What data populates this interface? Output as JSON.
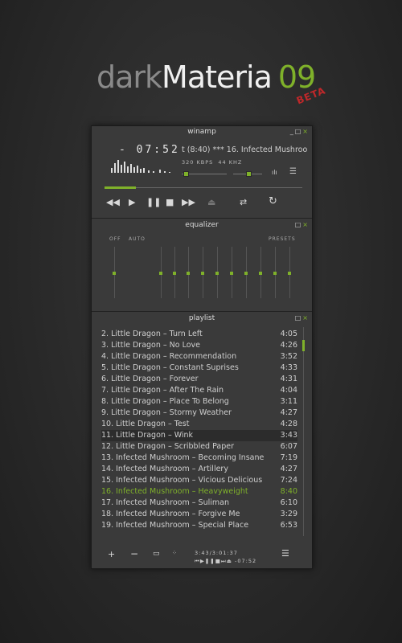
{
  "logo": {
    "dark": "dark",
    "materia": "Materia",
    "version": "09",
    "beta": "BETA"
  },
  "windows": {
    "main": "winamp",
    "eq": "equalizer",
    "playlist": "playlist"
  },
  "main": {
    "time": "- 07:52",
    "ticker": "t (8:40)  *** 16. Infected Mushroom",
    "kbps": "320",
    "kbps_label": "KBPS",
    "khz": "44",
    "khz_label": "KHZ",
    "seek_progress": 0.16
  },
  "eq": {
    "off": "OFF",
    "auto": "AUTO",
    "presets": "PRESETS"
  },
  "playlist": [
    {
      "title": "2. Little Dragon – Turn Left",
      "dur": "4:05"
    },
    {
      "title": "3. Little Dragon – No Love",
      "dur": "4:26"
    },
    {
      "title": "4. Little Dragon – Recommendation",
      "dur": "3:52"
    },
    {
      "title": "5. Little Dragon – Constant Suprises",
      "dur": "4:33"
    },
    {
      "title": "6. Little Dragon – Forever",
      "dur": "4:31"
    },
    {
      "title": "7. Little Dragon – After The Rain",
      "dur": "4:04"
    },
    {
      "title": "8. Little Dragon – Place To Belong",
      "dur": "3:11"
    },
    {
      "title": "9. Little Dragon – Stormy Weather",
      "dur": "4:27"
    },
    {
      "title": "10. Little Dragon – Test",
      "dur": "4:28"
    },
    {
      "title": "11. Little Dragon – Wink",
      "dur": "3:43"
    },
    {
      "title": "12. Little Dragon – Scribbled Paper",
      "dur": "6:07"
    },
    {
      "title": "13. Infected Mushroom – Becoming Insane",
      "dur": "7:19"
    },
    {
      "title": "14. Infected Mushroom – Artillery",
      "dur": "4:27"
    },
    {
      "title": "15. Infected Mushroom – Vicious Delicious",
      "dur": "7:24"
    },
    {
      "title": "16. Infected Mushroom – Heavyweight",
      "dur": "8:40"
    },
    {
      "title": "17. Infected Mushroom – Suliman",
      "dur": "6:10"
    },
    {
      "title": "18. Infected Mushroom – Forgive Me",
      "dur": "3:29"
    },
    {
      "title": "19. Infected Mushroom – Special Place",
      "dur": "6:53"
    }
  ],
  "playlist_footer": {
    "total": "3:43/3:01:37",
    "mini_time": "-07:52"
  },
  "colors": {
    "accent": "#7fb12a",
    "beta": "#c0282a"
  }
}
